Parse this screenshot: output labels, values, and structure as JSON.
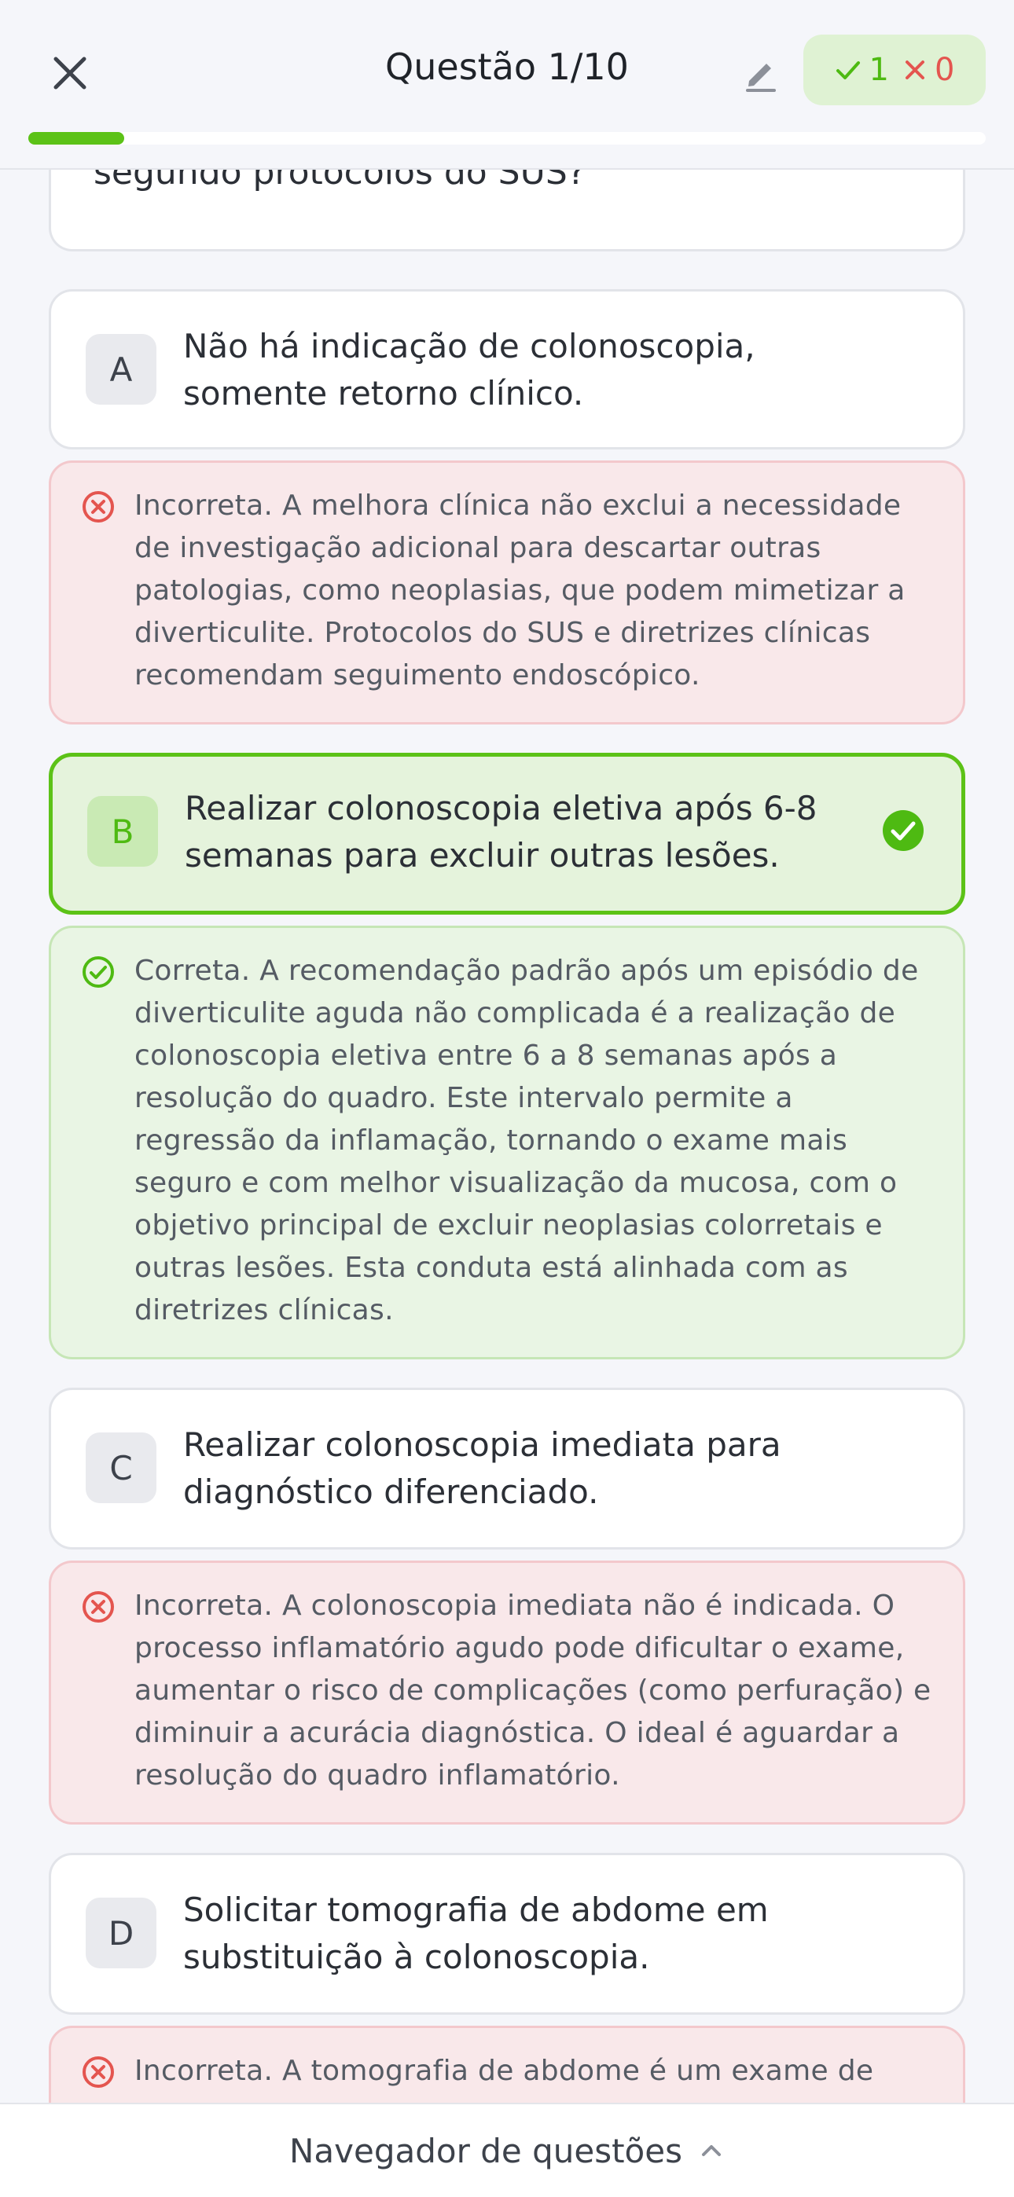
{
  "header": {
    "title": "Questão 1/10",
    "score_correct": "1",
    "score_wrong": "0",
    "progress_fraction": 0.1
  },
  "question": {
    "tail_text": "segundo protocolos do SUS?"
  },
  "options": [
    {
      "letter": "A",
      "text": "Não há indicação de colonoscopia, somente retorno clínico.",
      "feedback": "Incorreta. A melhora clínica não exclui a necessidade de investigação adicional para descartar outras patologias, como neoplasias, que podem mimetizar a diverticulite. Protocolos do SUS e diretrizes clínicas recomendam seguimento endoscópico."
    },
    {
      "letter": "B",
      "text": "Realizar colonoscopia eletiva após 6-8 semanas para excluir outras lesões.",
      "feedback": "Correta. A recomendação padrão após um episódio de diverticulite aguda não complicada é a realização de colonoscopia eletiva entre 6 a 8 semanas após a resolução do quadro. Este intervalo permite a regressão da inflamação, tornando o exame mais seguro e com melhor visualização da mucosa, com o objetivo principal de excluir neoplasias colorretais e outras lesões. Esta conduta está alinhada com as diretrizes clínicas."
    },
    {
      "letter": "C",
      "text": "Realizar colonoscopia imediata para diagnóstico diferenciado.",
      "feedback": "Incorreta. A colonoscopia imediata não é indicada. O processo inflamatório agudo pode dificultar o exame, aumentar o risco de complicações (como perfuração) e diminuir a acurácia diagnóstica. O ideal é aguardar a resolução do quadro inflamatório."
    },
    {
      "letter": "D",
      "text": "Solicitar tomografia de abdome em substituição à colonoscopia.",
      "feedback": "Incorreta. A tomografia de abdome é um exame de"
    }
  ],
  "footer": {
    "label": "Navegador de questões"
  },
  "colors": {
    "accent_green": "#5cc217",
    "wrong_red": "#e4554f"
  },
  "icons": {
    "close": "close-icon",
    "edit": "pencil-icon",
    "check": "check-icon",
    "cross": "x-icon",
    "chevron": "chevron-up-icon"
  }
}
